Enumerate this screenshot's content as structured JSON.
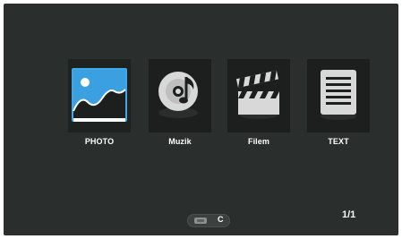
{
  "menu": {
    "items": [
      {
        "label": "PHOTO",
        "icon": "photo-icon",
        "selected": true
      },
      {
        "label": "Muzik",
        "icon": "music-icon",
        "selected": false
      },
      {
        "label": "Filem",
        "icon": "movie-icon",
        "selected": false
      },
      {
        "label": "TEXT",
        "icon": "text-icon",
        "selected": false
      }
    ]
  },
  "footer": {
    "source_icon": "usb-drive-icon",
    "drive_letter": "C",
    "page": "1/1"
  },
  "colors": {
    "background": "#2a2f2d",
    "tile": "#1c1f1e",
    "photo_accent": "#3aa0e0",
    "text": "#ffffff"
  }
}
